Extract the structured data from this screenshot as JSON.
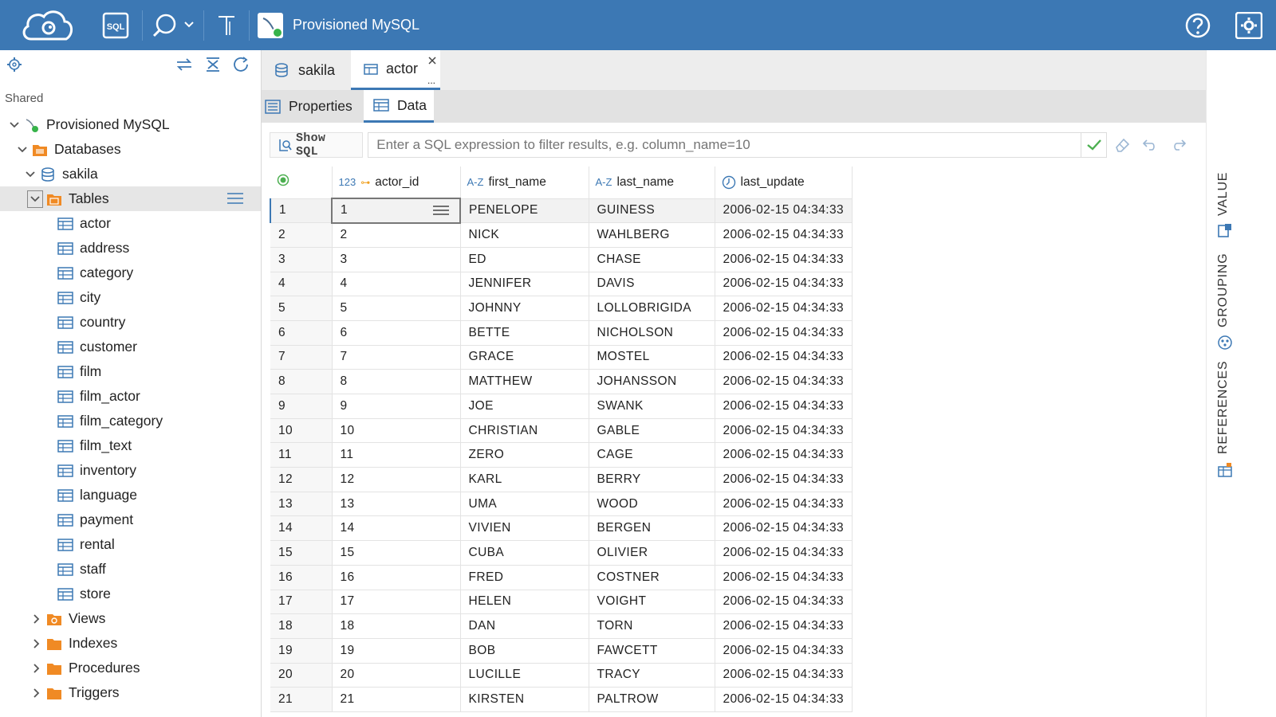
{
  "app": {
    "connection_title": "Provisioned MySQL"
  },
  "sidebar": {
    "section_label": "Shared",
    "connection": "Provisioned MySQL",
    "databases_label": "Databases",
    "schema": "sakila",
    "tables_label": "Tables",
    "tables": [
      "actor",
      "address",
      "category",
      "city",
      "country",
      "customer",
      "film",
      "film_actor",
      "film_category",
      "film_text",
      "inventory",
      "language",
      "payment",
      "rental",
      "staff",
      "store"
    ],
    "folders": [
      "Views",
      "Indexes",
      "Procedures",
      "Triggers"
    ]
  },
  "editor_tabs": [
    {
      "label": "sakila"
    },
    {
      "label": "actor",
      "more": "..."
    }
  ],
  "sub_tabs": [
    {
      "label": "Properties"
    },
    {
      "label": "Data"
    }
  ],
  "filter": {
    "show_sql_label": "Show SQL",
    "placeholder": "Enter a SQL expression to filter results, e.g. column_name=10"
  },
  "grid": {
    "columns": [
      {
        "type": "123",
        "name": "actor_id"
      },
      {
        "type": "A-Z",
        "name": "first_name"
      },
      {
        "type": "A-Z",
        "name": "last_name"
      },
      {
        "type": "clock",
        "name": "last_update"
      }
    ],
    "rows": [
      [
        "1",
        "1",
        "PENELOPE",
        "GUINESS",
        "2006-02-15 04:34:33"
      ],
      [
        "2",
        "2",
        "NICK",
        "WAHLBERG",
        "2006-02-15 04:34:33"
      ],
      [
        "3",
        "3",
        "ED",
        "CHASE",
        "2006-02-15 04:34:33"
      ],
      [
        "4",
        "4",
        "JENNIFER",
        "DAVIS",
        "2006-02-15 04:34:33"
      ],
      [
        "5",
        "5",
        "JOHNNY",
        "LOLLOBRIGIDA",
        "2006-02-15 04:34:33"
      ],
      [
        "6",
        "6",
        "BETTE",
        "NICHOLSON",
        "2006-02-15 04:34:33"
      ],
      [
        "7",
        "7",
        "GRACE",
        "MOSTEL",
        "2006-02-15 04:34:33"
      ],
      [
        "8",
        "8",
        "MATTHEW",
        "JOHANSSON",
        "2006-02-15 04:34:33"
      ],
      [
        "9",
        "9",
        "JOE",
        "SWANK",
        "2006-02-15 04:34:33"
      ],
      [
        "10",
        "10",
        "CHRISTIAN",
        "GABLE",
        "2006-02-15 04:34:33"
      ],
      [
        "11",
        "11",
        "ZERO",
        "CAGE",
        "2006-02-15 04:34:33"
      ],
      [
        "12",
        "12",
        "KARL",
        "BERRY",
        "2006-02-15 04:34:33"
      ],
      [
        "13",
        "13",
        "UMA",
        "WOOD",
        "2006-02-15 04:34:33"
      ],
      [
        "14",
        "14",
        "VIVIEN",
        "BERGEN",
        "2006-02-15 04:34:33"
      ],
      [
        "15",
        "15",
        "CUBA",
        "OLIVIER",
        "2006-02-15 04:34:33"
      ],
      [
        "16",
        "16",
        "FRED",
        "COSTNER",
        "2006-02-15 04:34:33"
      ],
      [
        "17",
        "17",
        "HELEN",
        "VOIGHT",
        "2006-02-15 04:34:33"
      ],
      [
        "18",
        "18",
        "DAN",
        "TORN",
        "2006-02-15 04:34:33"
      ],
      [
        "19",
        "19",
        "BOB",
        "FAWCETT",
        "2006-02-15 04:34:33"
      ],
      [
        "20",
        "20",
        "LUCILLE",
        "TRACY",
        "2006-02-15 04:34:33"
      ],
      [
        "21",
        "21",
        "KIRSTEN",
        "PALTROW",
        "2006-02-15 04:34:33"
      ]
    ]
  },
  "side_panels": [
    "VALUE",
    "GROUPING",
    "REFERENCES"
  ]
}
